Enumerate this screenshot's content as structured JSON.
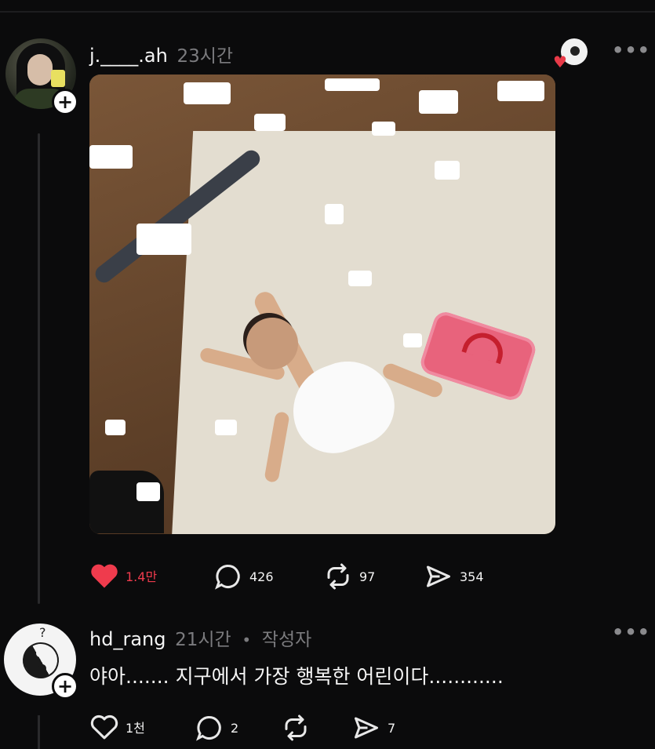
{
  "post": {
    "username": "j.____.ah",
    "time": "23시간",
    "actions": {
      "likes": "1.4만",
      "comments": "426",
      "reposts": "97",
      "shares": "354"
    }
  },
  "reply": {
    "username": "hd_rang",
    "time": "21시간",
    "author_tag": "작성자",
    "text": "야아....... 지구에서 가장 행복한 어린이다............",
    "actions": {
      "likes": "1천",
      "comments": "2",
      "shares": "7"
    }
  },
  "colors": {
    "background": "#0b0b0c",
    "like_red": "#ef3b4d",
    "muted_text": "#7b7b7e"
  }
}
